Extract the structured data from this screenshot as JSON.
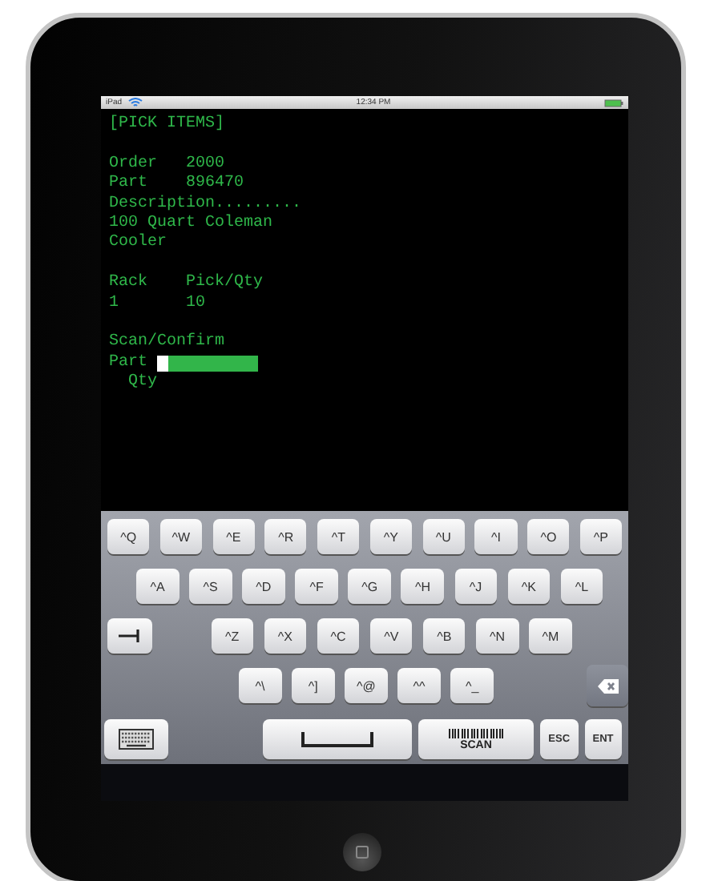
{
  "status_bar": {
    "device": "iPad",
    "time": "12:34 PM"
  },
  "terminal": {
    "lines": [
      {
        "kind": "text",
        "text": "[PICK ITEMS]"
      },
      {
        "kind": "blank"
      },
      {
        "kind": "text",
        "text": "Order   2000"
      },
      {
        "kind": "text",
        "text": "Part    896470"
      },
      {
        "kind": "text",
        "text": "Description........."
      },
      {
        "kind": "text",
        "text": "100 Quart Coleman"
      },
      {
        "kind": "text",
        "text": "Cooler"
      },
      {
        "kind": "blank"
      },
      {
        "kind": "text",
        "text": "Rack    Pick/Qty"
      },
      {
        "kind": "text",
        "text": "1       10"
      },
      {
        "kind": "blank"
      },
      {
        "kind": "text",
        "text": "Scan/Confirm"
      },
      {
        "kind": "field",
        "text": "Part "
      },
      {
        "kind": "text",
        "text": "  Qty"
      }
    ]
  },
  "keyboard": {
    "rows": [
      {
        "keys": [
          {
            "kind": "char",
            "label": "^Q"
          },
          {
            "kind": "char",
            "label": "^W"
          },
          {
            "kind": "char",
            "label": "^E"
          },
          {
            "kind": "char",
            "label": "^R"
          },
          {
            "kind": "char",
            "label": "^T"
          },
          {
            "kind": "char",
            "label": "^Y"
          },
          {
            "kind": "char",
            "label": "^U"
          },
          {
            "kind": "char",
            "label": "^I"
          },
          {
            "kind": "char",
            "label": "^O"
          },
          {
            "kind": "char",
            "label": "^P"
          }
        ]
      },
      {
        "keys": [
          {
            "kind": "char",
            "label": "^A"
          },
          {
            "kind": "char",
            "label": "^S"
          },
          {
            "kind": "char",
            "label": "^D"
          },
          {
            "kind": "char",
            "label": "^F"
          },
          {
            "kind": "char",
            "label": "^G"
          },
          {
            "kind": "char",
            "label": "^H"
          },
          {
            "kind": "char",
            "label": "^J"
          },
          {
            "kind": "char",
            "label": "^K"
          },
          {
            "kind": "char",
            "label": "^L"
          }
        ]
      },
      {
        "keys": [
          {
            "kind": "tab"
          },
          {
            "kind": "char",
            "label": "^Z"
          },
          {
            "kind": "char",
            "label": "^X"
          },
          {
            "kind": "char",
            "label": "^C"
          },
          {
            "kind": "char",
            "label": "^V"
          },
          {
            "kind": "char",
            "label": "^B"
          },
          {
            "kind": "char",
            "label": "^N"
          },
          {
            "kind": "char",
            "label": "^M"
          }
        ]
      },
      {
        "keys": [
          {
            "kind": "char",
            "label": "^\\"
          },
          {
            "kind": "char",
            "label": "^]"
          },
          {
            "kind": "char",
            "label": "^@"
          },
          {
            "kind": "char",
            "label": "^^"
          },
          {
            "kind": "char",
            "label": "^_"
          },
          {
            "kind": "backspace"
          }
        ]
      },
      {
        "keys": [
          {
            "kind": "keyboard"
          },
          {
            "kind": "space"
          },
          {
            "kind": "scan",
            "label": "SCAN"
          },
          {
            "kind": "small",
            "label": "ESC"
          },
          {
            "kind": "small",
            "label": "ENT"
          }
        ]
      }
    ]
  }
}
